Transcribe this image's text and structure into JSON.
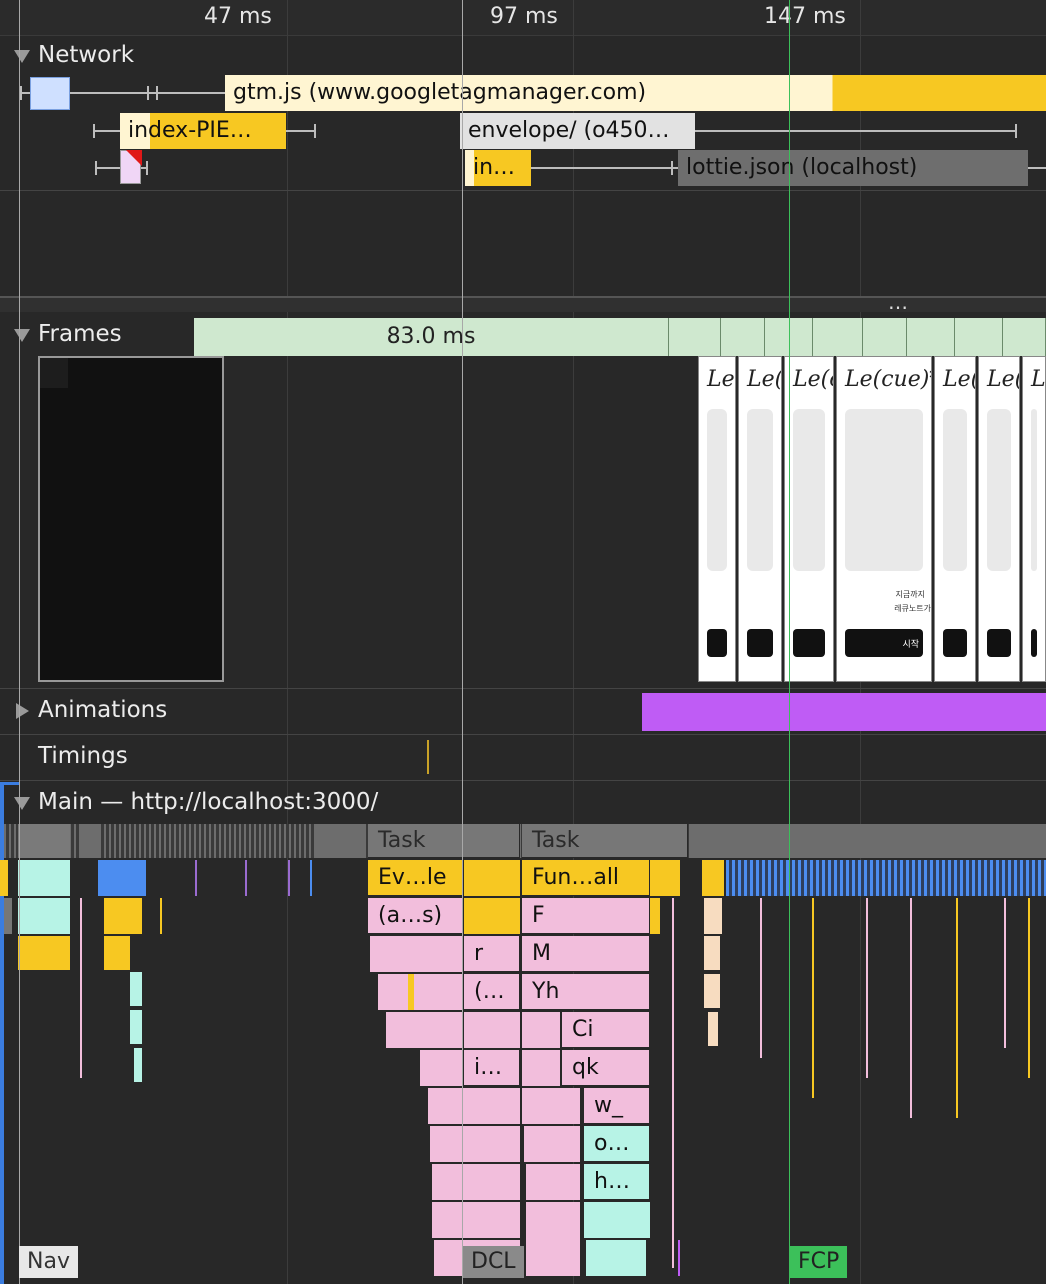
{
  "ruler": {
    "ticks": [
      "47 ms",
      "97 ms",
      "147 ms"
    ]
  },
  "network": {
    "title": "Network",
    "requests": [
      {
        "label": "gtm.js (www.googletagmanager.com)",
        "color": "#f7c822"
      },
      {
        "label": "index-PIE…",
        "color": "#f7c822"
      },
      {
        "label": "envelope/ (o450…",
        "color": "#dcdcdc"
      },
      {
        "label": "in…",
        "color": "#f7c822"
      },
      {
        "label": "lottie.json (localhost)",
        "color": "#6e6e6e"
      }
    ]
  },
  "overflow_menu": "…",
  "frames": {
    "title": "Frames",
    "duration": "83.0 ms",
    "logo_text": "Le(cue)*",
    "thumb_text_line1": "지금까지",
    "thumb_text_line2": "레큐노트가",
    "thumb_button": "시작"
  },
  "animations": {
    "title": "Animations",
    "color": "#bf5cf5"
  },
  "timings": {
    "title": "Timings"
  },
  "main": {
    "title": "Main — http://localhost:3000/",
    "tasks": [
      "Task",
      "Task"
    ],
    "events": [
      "Ev…le",
      "Fun…all",
      "(a…s)",
      "F",
      "r",
      "M",
      "(…",
      "Yh",
      "Ci",
      "i…",
      "qk",
      "w_",
      "o…",
      "h…"
    ]
  },
  "markers": {
    "nav": "Nav",
    "dcl": "DCL",
    "fcp": "FCP"
  },
  "colors": {
    "script": "#f7c822",
    "function": "#f2bedc",
    "parse": "#b7f3e6",
    "fcp": "#3cc05a",
    "task": "#777777"
  }
}
